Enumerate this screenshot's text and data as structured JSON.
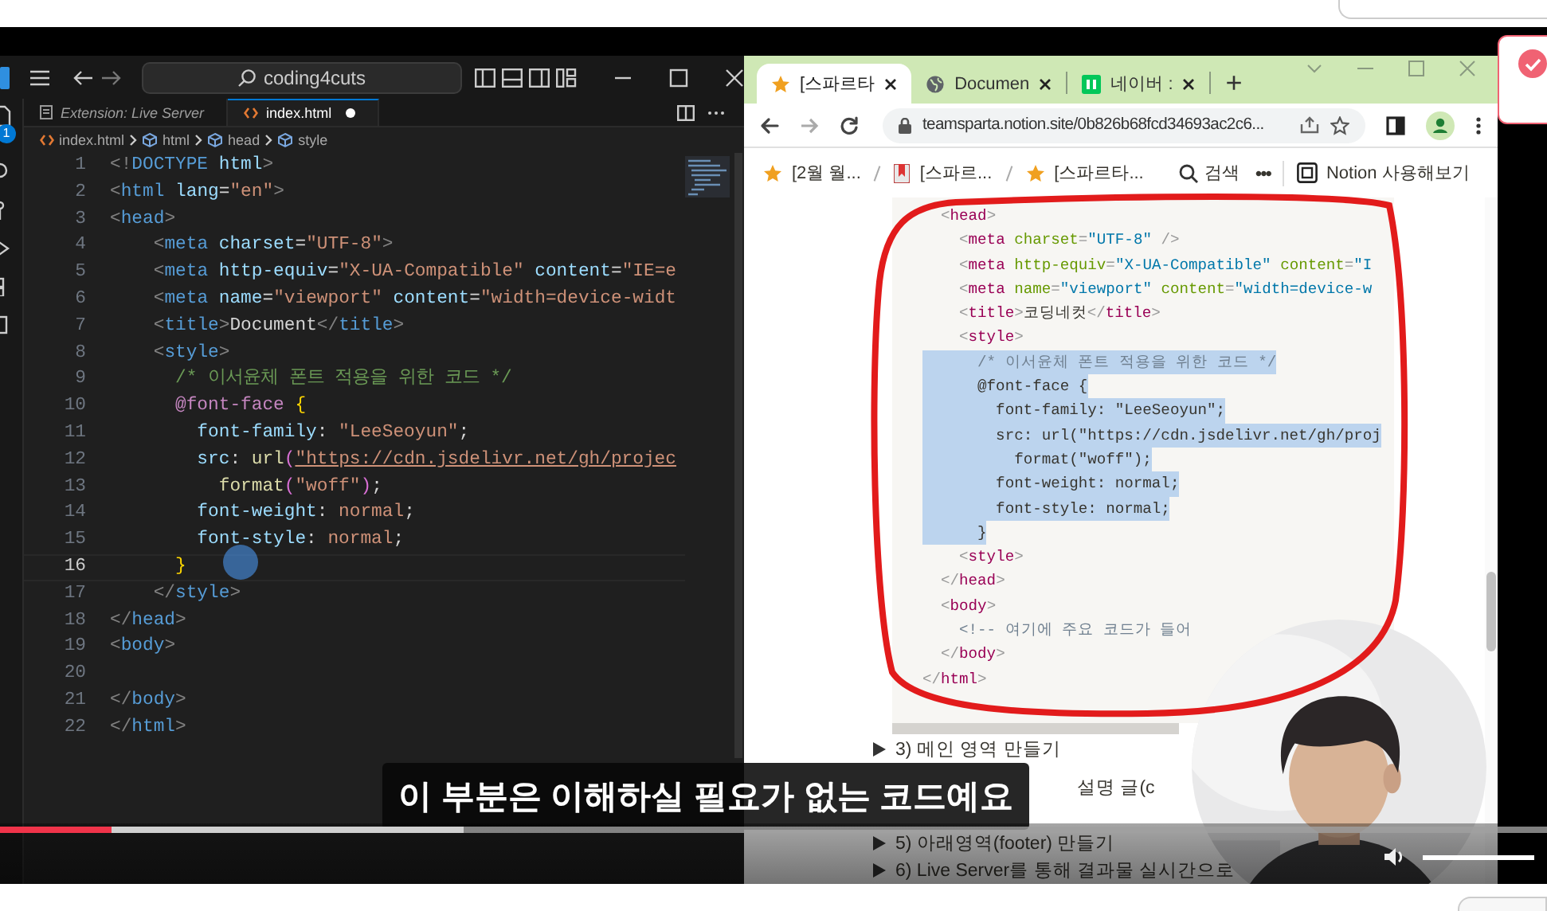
{
  "vscode": {
    "search": "coding4cuts",
    "badge": "1",
    "tabs": [
      {
        "label": "Extension: Live Server",
        "selected": false,
        "modified": false
      },
      {
        "label": "index.html",
        "selected": true,
        "modified": true
      }
    ],
    "breadcrumbs": [
      "index.html",
      "html",
      "head",
      "style"
    ],
    "lines": [
      {
        "number": "1",
        "selected": false,
        "tokens": [
          {
            "kind": "punct",
            "text": "<!"
          },
          {
            "kind": "tag",
            "text": "DOCTYPE"
          },
          {
            "kind": "attr",
            "text": " html"
          },
          {
            "kind": "punct",
            "text": ">"
          }
        ]
      },
      {
        "number": "2",
        "selected": false,
        "tokens": [
          {
            "kind": "punct",
            "text": "<"
          },
          {
            "kind": "tag",
            "text": "html"
          },
          {
            "kind": "attr",
            "text": " lang"
          },
          {
            "kind": "text",
            "text": "="
          },
          {
            "kind": "string",
            "text": "\"en\""
          },
          {
            "kind": "punct",
            "text": ">"
          }
        ]
      },
      {
        "number": "3",
        "selected": false,
        "tokens": [
          {
            "kind": "punct",
            "text": "<"
          },
          {
            "kind": "tag",
            "text": "head"
          },
          {
            "kind": "punct",
            "text": ">"
          }
        ]
      },
      {
        "number": "4",
        "selected": false,
        "tokens": [
          {
            "kind": "punct",
            "text": "    <"
          },
          {
            "kind": "tag",
            "text": "meta"
          },
          {
            "kind": "attr",
            "text": " charset"
          },
          {
            "kind": "text",
            "text": "="
          },
          {
            "kind": "string",
            "text": "\"UTF-8\""
          },
          {
            "kind": "punct",
            "text": ">"
          }
        ]
      },
      {
        "number": "5",
        "selected": false,
        "tokens": [
          {
            "kind": "punct",
            "text": "    <"
          },
          {
            "kind": "tag",
            "text": "meta"
          },
          {
            "kind": "attr",
            "text": " http-equiv"
          },
          {
            "kind": "text",
            "text": "="
          },
          {
            "kind": "string",
            "text": "\"X-UA-Compatible\""
          },
          {
            "kind": "attr",
            "text": " content"
          },
          {
            "kind": "text",
            "text": "="
          },
          {
            "kind": "string",
            "text": "\"IE=e"
          }
        ]
      },
      {
        "number": "6",
        "selected": false,
        "tokens": [
          {
            "kind": "punct",
            "text": "    <"
          },
          {
            "kind": "tag",
            "text": "meta"
          },
          {
            "kind": "attr",
            "text": " name"
          },
          {
            "kind": "text",
            "text": "="
          },
          {
            "kind": "string",
            "text": "\"viewport\""
          },
          {
            "kind": "attr",
            "text": " content"
          },
          {
            "kind": "text",
            "text": "="
          },
          {
            "kind": "string",
            "text": "\"width=device-widt"
          }
        ]
      },
      {
        "number": "7",
        "selected": false,
        "tokens": [
          {
            "kind": "punct",
            "text": "    <"
          },
          {
            "kind": "tag",
            "text": "title"
          },
          {
            "kind": "punct",
            "text": ">"
          },
          {
            "kind": "text",
            "text": "Document"
          },
          {
            "kind": "punct",
            "text": "</"
          },
          {
            "kind": "tag",
            "text": "title"
          },
          {
            "kind": "punct",
            "text": ">"
          }
        ]
      },
      {
        "number": "8",
        "selected": false,
        "tokens": [
          {
            "kind": "punct",
            "text": "    <"
          },
          {
            "kind": "tag",
            "text": "style"
          },
          {
            "kind": "punct",
            "text": ">"
          }
        ]
      },
      {
        "number": "9",
        "selected": false,
        "tokens": [
          {
            "kind": "comment",
            "text": "      /* 이서윤체 폰트 적용을 위한 코드 */"
          }
        ]
      },
      {
        "number": "10",
        "selected": false,
        "tokens": [
          {
            "kind": "atrule",
            "text": "      @font-face "
          },
          {
            "kind": "match",
            "text": "{"
          }
        ]
      },
      {
        "number": "11",
        "selected": false,
        "tokens": [
          {
            "kind": "prop",
            "text": "        font-family"
          },
          {
            "kind": "text",
            "text": ": "
          },
          {
            "kind": "string",
            "text": "\"LeeSeoyun\""
          },
          {
            "kind": "text",
            "text": ";"
          }
        ]
      },
      {
        "number": "12",
        "selected": false,
        "tokens": [
          {
            "kind": "prop",
            "text": "        src"
          },
          {
            "kind": "text",
            "text": ": "
          },
          {
            "kind": "func",
            "text": "url"
          },
          {
            "kind": "brace",
            "text": "("
          },
          {
            "kind": "url",
            "text": "\"https://cdn.jsdelivr.net/gh/projec"
          }
        ]
      },
      {
        "number": "13",
        "selected": false,
        "tokens": [
          {
            "kind": "func",
            "text": "          format"
          },
          {
            "kind": "brace",
            "text": "("
          },
          {
            "kind": "string",
            "text": "\"woff\""
          },
          {
            "kind": "brace",
            "text": ")"
          },
          {
            "kind": "text",
            "text": ";"
          }
        ]
      },
      {
        "number": "14",
        "selected": false,
        "tokens": [
          {
            "kind": "prop",
            "text": "        font-weight"
          },
          {
            "kind": "text",
            "text": ": "
          },
          {
            "kind": "string",
            "text": "normal"
          },
          {
            "kind": "text",
            "text": ";"
          }
        ]
      },
      {
        "number": "15",
        "selected": false,
        "tokens": [
          {
            "kind": "prop",
            "text": "        font-style"
          },
          {
            "kind": "text",
            "text": ": "
          },
          {
            "kind": "string",
            "text": "normal"
          },
          {
            "kind": "text",
            "text": ";"
          }
        ]
      },
      {
        "number": "16",
        "selected": true,
        "tokens": [
          {
            "kind": "match",
            "text": "      }"
          }
        ]
      },
      {
        "number": "17",
        "selected": false,
        "tokens": [
          {
            "kind": "punct",
            "text": "    </"
          },
          {
            "kind": "tag",
            "text": "style"
          },
          {
            "kind": "punct",
            "text": ">"
          }
        ]
      },
      {
        "number": "18",
        "selected": false,
        "tokens": [
          {
            "kind": "punct",
            "text": "</"
          },
          {
            "kind": "tag",
            "text": "head"
          },
          {
            "kind": "punct",
            "text": ">"
          }
        ]
      },
      {
        "number": "19",
        "selected": false,
        "tokens": [
          {
            "kind": "punct",
            "text": "<"
          },
          {
            "kind": "tag",
            "text": "body"
          },
          {
            "kind": "punct",
            "text": ">"
          }
        ]
      },
      {
        "number": "20",
        "selected": false
      },
      {
        "number": "21",
        "selected": false,
        "tokens": [
          {
            "kind": "punct",
            "text": "</"
          },
          {
            "kind": "tag",
            "text": "body"
          },
          {
            "kind": "punct",
            "text": ">"
          }
        ]
      },
      {
        "number": "22",
        "selected": false,
        "tokens": [
          {
            "kind": "punct",
            "text": "</"
          },
          {
            "kind": "tag",
            "text": "html"
          },
          {
            "kind": "punct",
            "text": ">"
          }
        ]
      }
    ]
  },
  "browser": {
    "tabs": [
      {
        "label": "[스파르타",
        "kind": "star",
        "selected": true
      },
      {
        "label": "Documen",
        "kind": "globe",
        "selected": false
      },
      {
        "label": "네이버 :",
        "kind": "naver",
        "selected": false
      }
    ],
    "new_tab": "+",
    "url": "teamsparta.notion.site/0b826b68fcd34693ac2c6...",
    "page_breadcrumbs": [
      {
        "label": "[2월 월...",
        "kind": "star"
      },
      {
        "label": "[스파르...",
        "kind": "bookmark"
      },
      {
        "label": "[스파르타...",
        "kind": "star"
      }
    ],
    "search_label": "검색",
    "more": "•••",
    "try_notion": "Notion 사용해보기",
    "code_lines": [
      {
        "selected": false,
        "tokens": [
          {
            "kind": "punct",
            "text": "  <"
          },
          {
            "kind": "tag",
            "text": "head"
          },
          {
            "kind": "punct",
            "text": ">"
          }
        ]
      },
      {
        "selected": false,
        "tokens": [
          {
            "kind": "punct",
            "text": "    <"
          },
          {
            "kind": "tag",
            "text": "meta"
          },
          {
            "kind": "attr",
            "text": " charset"
          },
          {
            "kind": "punct",
            "text": "="
          },
          {
            "kind": "string",
            "text": "\"UTF-8\""
          },
          {
            "kind": "punct",
            "text": " />"
          }
        ]
      },
      {
        "selected": false,
        "tokens": [
          {
            "kind": "punct",
            "text": "    <"
          },
          {
            "kind": "tag",
            "text": "meta"
          },
          {
            "kind": "attr",
            "text": " http-equiv"
          },
          {
            "kind": "punct",
            "text": "="
          },
          {
            "kind": "string",
            "text": "\"X-UA-Compatible\""
          },
          {
            "kind": "attr",
            "text": " content"
          },
          {
            "kind": "punct",
            "text": "="
          },
          {
            "kind": "string",
            "text": "\"I"
          }
        ]
      },
      {
        "selected": false,
        "tokens": [
          {
            "kind": "punct",
            "text": "    <"
          },
          {
            "kind": "tag",
            "text": "meta"
          },
          {
            "kind": "attr",
            "text": " name"
          },
          {
            "kind": "punct",
            "text": "="
          },
          {
            "kind": "string",
            "text": "\"viewport\""
          },
          {
            "kind": "attr",
            "text": " content"
          },
          {
            "kind": "punct",
            "text": "="
          },
          {
            "kind": "string",
            "text": "\"width=device-w"
          }
        ]
      },
      {
        "selected": false,
        "tokens": [
          {
            "kind": "punct",
            "text": "    <"
          },
          {
            "kind": "tag",
            "text": "title"
          },
          {
            "kind": "punct",
            "text": ">"
          },
          {
            "kind": "text",
            "text": "코딩네컷"
          },
          {
            "kind": "punct",
            "text": "</"
          },
          {
            "kind": "tag",
            "text": "title"
          },
          {
            "kind": "punct",
            "text": ">"
          }
        ]
      },
      {
        "selected": false,
        "tokens": [
          {
            "kind": "punct",
            "text": "    <"
          },
          {
            "kind": "tag",
            "text": "style"
          },
          {
            "kind": "punct",
            "text": ">"
          }
        ]
      },
      {
        "selected": true,
        "tokens": [
          {
            "kind": "comment",
            "text": "      /* 이서윤체 폰트 적용을 위한 코드 */"
          }
        ]
      },
      {
        "selected": true,
        "tokens": [
          {
            "kind": "text",
            "text": "      @font-face {"
          }
        ]
      },
      {
        "selected": true,
        "tokens": [
          {
            "kind": "text",
            "text": "        font-family: \"LeeSeoyun\";"
          }
        ]
      },
      {
        "selected": true,
        "tokens": [
          {
            "kind": "text",
            "text": "        src: url(\"https://cdn.jsdelivr.net/gh/proj"
          }
        ]
      },
      {
        "selected": true,
        "tokens": [
          {
            "kind": "text",
            "text": "          format(\"woff\");"
          }
        ]
      },
      {
        "selected": true,
        "tokens": [
          {
            "kind": "text",
            "text": "        font-weight: normal;"
          }
        ]
      },
      {
        "selected": true,
        "tokens": [
          {
            "kind": "text",
            "text": "        font-style: normal;"
          }
        ]
      },
      {
        "selected": true,
        "tokens": [
          {
            "kind": "text",
            "text": "      }"
          }
        ]
      },
      {
        "selected": false,
        "tokens": [
          {
            "kind": "punct",
            "text": "    <"
          },
          {
            "kind": "tag",
            "text": "style"
          },
          {
            "kind": "punct",
            "text": ">"
          }
        ]
      },
      {
        "selected": false,
        "tokens": [
          {
            "kind": "punct",
            "text": "  </"
          },
          {
            "kind": "tag",
            "text": "head"
          },
          {
            "kind": "punct",
            "text": ">"
          }
        ]
      },
      {
        "selected": false,
        "tokens": [
          {
            "kind": "punct",
            "text": "  <"
          },
          {
            "kind": "tag",
            "text": "body"
          },
          {
            "kind": "punct",
            "text": ">"
          }
        ]
      },
      {
        "selected": false,
        "tokens": [
          {
            "kind": "comment",
            "text": "    <!-- 여기에 주요 코드가 들어"
          }
        ]
      },
      {
        "selected": false,
        "tokens": [
          {
            "kind": "punct",
            "text": "  </"
          },
          {
            "kind": "tag",
            "text": "body"
          },
          {
            "kind": "punct",
            "text": ">"
          }
        ]
      },
      {
        "selected": false,
        "tokens": [
          {
            "kind": "punct",
            "text": "</"
          },
          {
            "kind": "tag",
            "text": "html"
          },
          {
            "kind": "punct",
            "text": ">"
          }
        ]
      }
    ],
    "list_items": [
      {
        "label": "3) 메인 영역 만들기",
        "covered": false
      },
      {
        "label": "설명 글(c",
        "covered": true
      },
      {
        "label": "5) 아래영역(footer) 만들기",
        "covered": false
      },
      {
        "label": "6) Live Server를 통해 결과물 실시간으로",
        "covered": false
      }
    ]
  },
  "subtitle": "이 부분은 이해하실 필요가 없는 코드예요",
  "player": {
    "progress": {
      "level": 0.072
    },
    "buffered": {
      "level": 0.3
    },
    "volume": {
      "level": 1
    }
  }
}
